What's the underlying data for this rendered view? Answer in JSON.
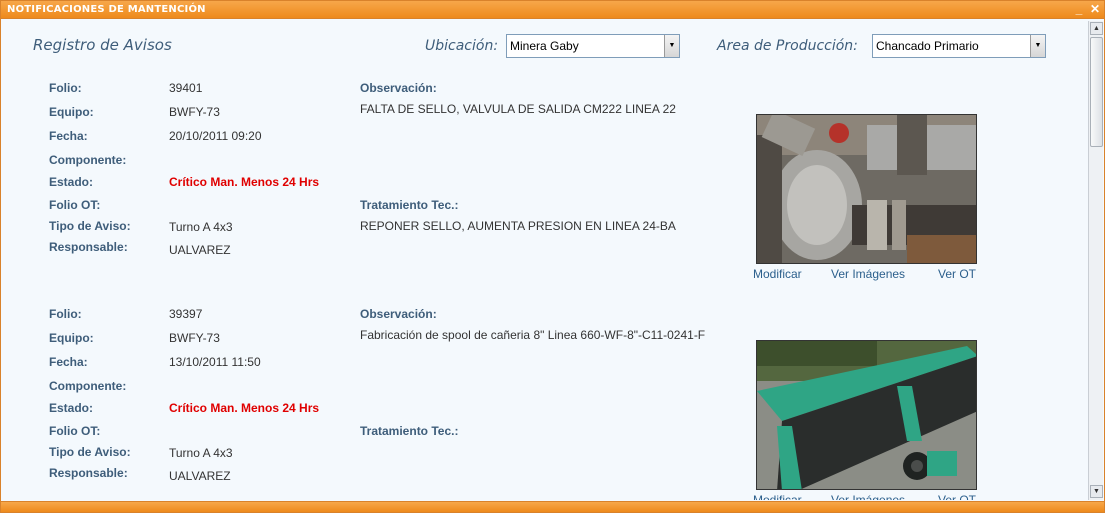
{
  "window": {
    "title": "NOTIFICACIONES DE MANTENCIÓN",
    "minimize_label": "_",
    "close_label": "✕"
  },
  "header": {
    "title": "Registro de Avisos",
    "ubicacion_label": "Ubicación:",
    "ubicacion_value": "Minera Gaby",
    "area_label": "Area de Producción:",
    "area_value": "Chancado Primario"
  },
  "labels": {
    "folio": "Folio:",
    "equipo": "Equipo:",
    "fecha": "Fecha:",
    "componente": "Componente:",
    "estado": "Estado:",
    "folio_ot": "Folio OT:",
    "tipo_aviso": "Tipo de Aviso:",
    "responsable": "Responsable:",
    "observacion": "Observación:",
    "tratamiento": "Tratamiento Tec.:",
    "modificar": "Modificar",
    "ver_imagenes": "Ver Imágenes",
    "ver_ot": "Ver OT"
  },
  "records": [
    {
      "folio": "39401",
      "equipo": "BWFY-73",
      "fecha": "20/10/2011 09:20",
      "componente": "",
      "estado": "Crítico Man. Menos 24 Hrs",
      "folio_ot": "",
      "tipo_aviso": "Turno A 4x3",
      "responsable": "UALVAREZ",
      "observacion": "FALTA DE SELLO, VALVULA DE SALIDA CM222 LINEA 22",
      "tratamiento": "REPONER SELLO, AUMENTA PRESION EN LINEA 24-BA",
      "image_icon": "valve-photo"
    },
    {
      "folio": "39397",
      "equipo": "BWFY-73",
      "fecha": "13/10/2011 11:50",
      "componente": "",
      "estado": "Crítico Man. Menos 24 Hrs",
      "folio_ot": "",
      "tipo_aviso": "Turno A 4x3",
      "responsable": "UALVAREZ",
      "observacion": "Fabricación de spool de cañeria 8\" Linea 660-WF-8\"-C11-0241-F",
      "tratamiento": "",
      "image_icon": "conveyor-photo"
    }
  ],
  "colors": {
    "accent_orange": "#ee8a1c",
    "label_blue": "#3e5d7a",
    "critical_red": "#e00000",
    "link_blue": "#2b5f8c"
  }
}
